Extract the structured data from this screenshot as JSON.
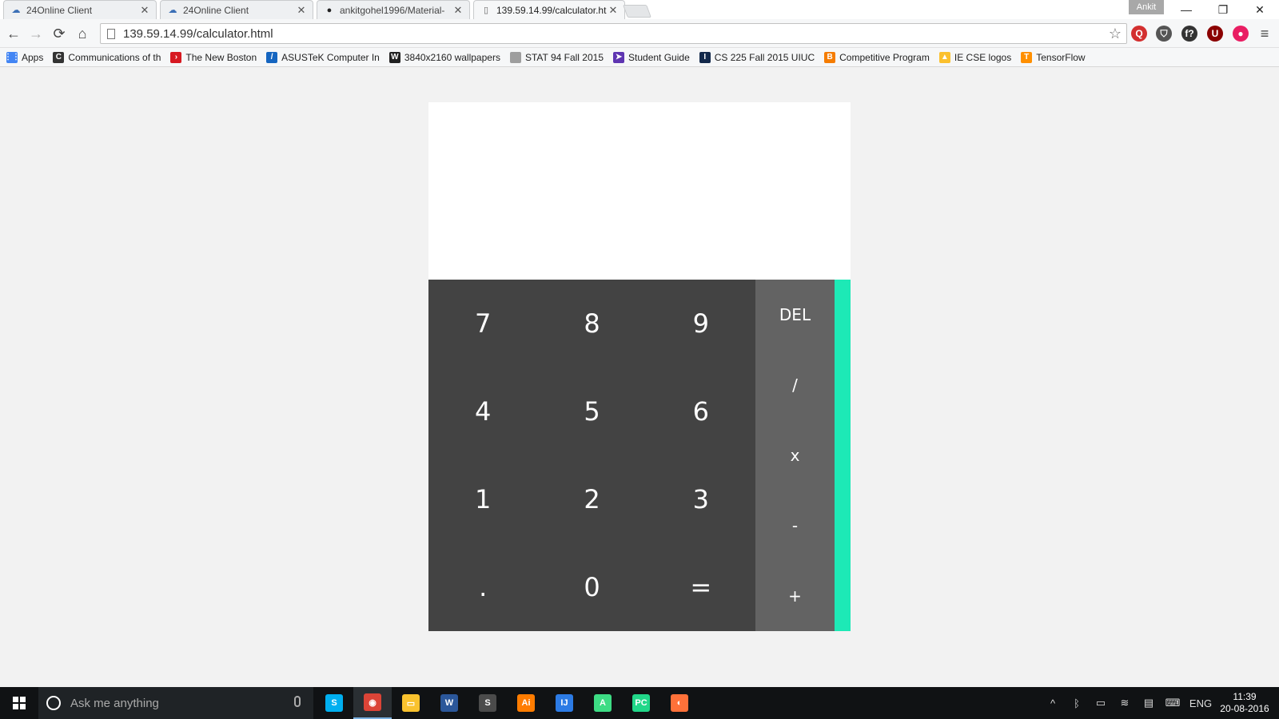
{
  "tabs": [
    {
      "label": "24Online Client",
      "favicon": "cloud-icon"
    },
    {
      "label": "24Online Client",
      "favicon": "cloud-icon"
    },
    {
      "label": "ankitgohel1996/Material-",
      "favicon": "github-icon"
    },
    {
      "label": "139.59.14.99/calculator.ht",
      "favicon": "page-icon"
    }
  ],
  "profile_name": "Ankit",
  "window_controls": {
    "minimize": "—",
    "restore": "❐",
    "close": "✕"
  },
  "toolbar": {
    "back": "←",
    "forward": "→",
    "reload": "⟳",
    "home": "⌂",
    "url": "139.59.14.99/calculator.html",
    "star": "☆",
    "menu": "≡"
  },
  "extensions": [
    {
      "name": "quotes-extension-icon",
      "glyph": "Q",
      "color": "#d32f2f"
    },
    {
      "name": "pocket-extension-icon",
      "glyph": "⛉",
      "color": "#555555"
    },
    {
      "name": "formula-extension-icon",
      "glyph": "f?",
      "color": "#333333"
    },
    {
      "name": "ublock-extension-icon",
      "glyph": "U",
      "color": "#8b0000"
    },
    {
      "name": "color-picker-extension-icon",
      "glyph": "●",
      "color": "#e91e63"
    }
  ],
  "bookmarks": [
    {
      "label": "Apps",
      "icon": "apps-grid-icon",
      "color": "#4285f4",
      "glyph": "⋮⋮"
    },
    {
      "label": "Communications of th",
      "icon": "c-icon",
      "color": "#333333",
      "glyph": "C"
    },
    {
      "label": "The New Boston",
      "icon": "newboston-icon",
      "color": "#d71921",
      "glyph": "›"
    },
    {
      "label": "ASUSTeK Computer In",
      "icon": "asus-icon",
      "color": "#1565c0",
      "glyph": "/"
    },
    {
      "label": "3840x2160 wallpapers",
      "icon": "w-icon",
      "color": "#222222",
      "glyph": "W"
    },
    {
      "label": "STAT 94 Fall 2015",
      "icon": "doc-icon",
      "color": "#9e9e9e",
      "glyph": ""
    },
    {
      "label": "Student Guide",
      "icon": "student-guide-icon",
      "color": "#5e35b1",
      "glyph": "➤"
    },
    {
      "label": "CS 225 Fall 2015 UIUC",
      "icon": "illinois-icon",
      "color": "#13294b",
      "glyph": "I"
    },
    {
      "label": "Competitive Program",
      "icon": "blogger-icon",
      "color": "#f57c00",
      "glyph": "B"
    },
    {
      "label": "IE CSE logos",
      "icon": "drive-icon",
      "color": "#fbc02d",
      "glyph": "▲"
    },
    {
      "label": "TensorFlow",
      "icon": "tensorflow-icon",
      "color": "#ff8f00",
      "glyph": "T"
    }
  ],
  "calculator": {
    "display": "",
    "keys": [
      "7",
      "8",
      "9",
      "4",
      "5",
      "6",
      "1",
      "2",
      "3",
      ".",
      "0",
      "="
    ],
    "operators": [
      "DEL",
      "/",
      "x",
      "-",
      "+"
    ],
    "colors": {
      "numpad": "#434343",
      "operators": "#636363",
      "accent": "#1de9b6",
      "display": "#ffffff"
    }
  },
  "taskbar": {
    "search_placeholder": "Ask me anything",
    "apps": [
      {
        "name": "skype",
        "glyph": "S",
        "color": "#00aff0"
      },
      {
        "name": "chrome",
        "glyph": "◉",
        "color": "#db4437"
      },
      {
        "name": "file-explorer",
        "glyph": "▭",
        "color": "#f9c22e"
      },
      {
        "name": "word",
        "glyph": "W",
        "color": "#2b579a"
      },
      {
        "name": "sublime-text",
        "glyph": "S",
        "color": "#4b4b4b"
      },
      {
        "name": "illustrator",
        "glyph": "Ai",
        "color": "#ff7c00"
      },
      {
        "name": "intellij",
        "glyph": "IJ",
        "color": "#2c7be5"
      },
      {
        "name": "android-studio",
        "glyph": "A",
        "color": "#3ddc84"
      },
      {
        "name": "pycharm",
        "glyph": "PC",
        "color": "#21d789"
      },
      {
        "name": "firefox",
        "glyph": "◐",
        "color": "#ff7139"
      }
    ],
    "tray": {
      "chevron": "^",
      "bluetooth": "ᛒ",
      "battery": "▭",
      "wifi": "≋",
      "notifications": "▤",
      "keyboard": "⌨",
      "language": "ENG"
    },
    "time": "11:39",
    "date": "20-08-2016"
  }
}
